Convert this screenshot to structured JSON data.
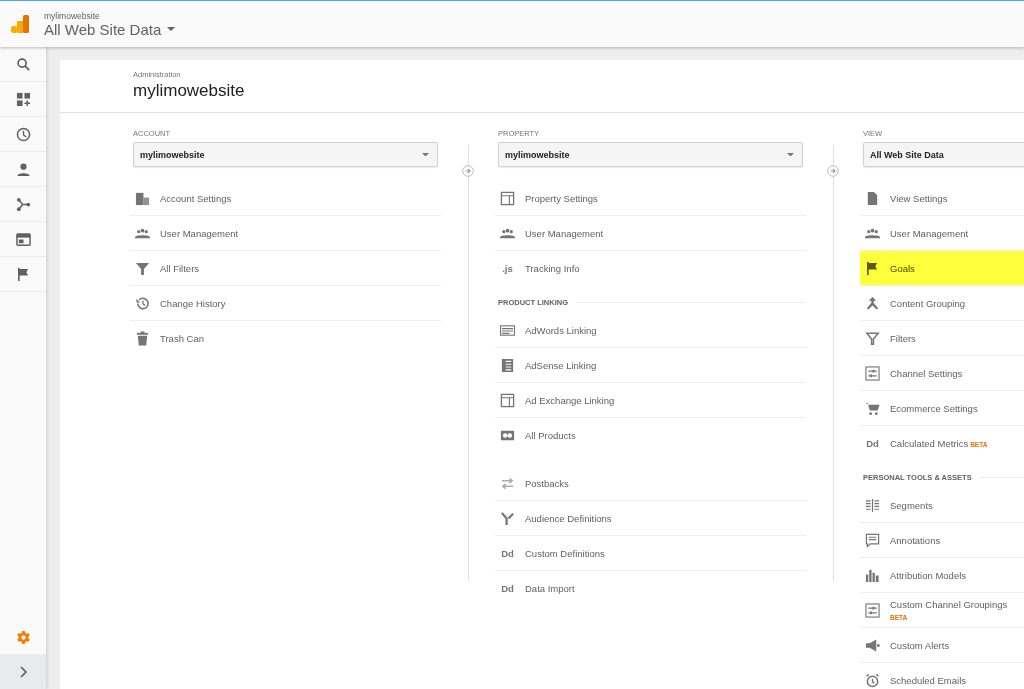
{
  "header": {
    "account_name": "mylimowebsite",
    "view_name": "All Web Site Data"
  },
  "sidebar": {
    "items": [
      {
        "kind": "search",
        "selected": false
      },
      {
        "kind": "dashboard",
        "selected": false
      },
      {
        "kind": "clock",
        "selected": false
      },
      {
        "kind": "person",
        "selected": false
      },
      {
        "kind": "nodes",
        "selected": false
      },
      {
        "kind": "window",
        "selected": false
      },
      {
        "kind": "flag",
        "selected": false
      }
    ],
    "admin": {
      "kind": "gear",
      "selected": true
    }
  },
  "page": {
    "breadcrumb": "Administration",
    "title": "mylimowebsite"
  },
  "columns": [
    {
      "label": "ACCOUNT",
      "dropdown": "mylimowebsite",
      "sections": [
        {
          "items": [
            {
              "label": "Account Settings",
              "kind": "building",
              "highlighted": false
            },
            {
              "label": "User Management",
              "kind": "people",
              "highlighted": false
            },
            {
              "label": "All Filters",
              "kind": "filter",
              "highlighted": false
            },
            {
              "label": "Change History",
              "kind": "history",
              "highlighted": false
            },
            {
              "label": "Trash Can",
              "kind": "trash",
              "highlighted": false
            }
          ]
        }
      ]
    },
    {
      "label": "PROPERTY",
      "dropdown": "mylimowebsite",
      "sections": [
        {
          "items": [
            {
              "label": "Property Settings",
              "kind": "panel",
              "highlighted": false
            },
            {
              "label": "User Management",
              "kind": "people",
              "highlighted": false
            },
            {
              "label": "Tracking Info",
              "kind": "text",
              "icon_text": ".js",
              "highlighted": false
            }
          ]
        },
        {
          "heading": "PRODUCT LINKING",
          "items": [
            {
              "label": "AdWords Linking",
              "kind": "card",
              "highlighted": false
            },
            {
              "label": "AdSense Linking",
              "kind": "listdoc",
              "highlighted": false
            },
            {
              "label": "Ad Exchange Linking",
              "kind": "panel",
              "highlighted": false
            },
            {
              "label": "All Products",
              "kind": "link",
              "highlighted": false
            }
          ]
        },
        {
          "items": [
            {
              "label": "Postbacks",
              "kind": "arrows",
              "highlighted": false
            },
            {
              "label": "Audience Definitions",
              "kind": "fork",
              "highlighted": false
            },
            {
              "label": "Custom Definitions",
              "kind": "text",
              "icon_text": "Dd",
              "highlighted": false
            },
            {
              "label": "Data Import",
              "kind": "text",
              "icon_text": "Dd",
              "highlighted": false
            }
          ]
        }
      ]
    },
    {
      "label": "VIEW",
      "dropdown": "All Web Site Data",
      "sections": [
        {
          "items": [
            {
              "label": "View Settings",
              "kind": "document",
              "highlighted": false
            },
            {
              "label": "User Management",
              "kind": "people",
              "highlighted": false
            },
            {
              "label": "Goals",
              "kind": "flag",
              "highlighted": true
            },
            {
              "label": "Content Grouping",
              "kind": "merge",
              "highlighted": false
            },
            {
              "label": "Filters",
              "kind": "filteroutline",
              "highlighted": false
            },
            {
              "label": "Channel Settings",
              "kind": "channel",
              "highlighted": false
            },
            {
              "label": "Ecommerce Settings",
              "kind": "cart",
              "highlighted": false
            },
            {
              "label": "Calculated Metrics",
              "kind": "text",
              "icon_text": "Dd",
              "badge": "BETA",
              "highlighted": false
            }
          ]
        },
        {
          "heading": "PERSONAL TOOLS & ASSETS",
          "items": [
            {
              "label": "Segments",
              "kind": "segments",
              "highlighted": false
            },
            {
              "label": "Annotations",
              "kind": "bubble",
              "highlighted": false
            },
            {
              "label": "Attribution Models",
              "kind": "bars",
              "highlighted": false
            },
            {
              "label": "Custom Channel Groupings",
              "kind": "channel",
              "badge": "BETA",
              "badge_below": true,
              "highlighted": false
            },
            {
              "label": "Custom Alerts",
              "kind": "megaphone",
              "highlighted": false
            },
            {
              "label": "Scheduled Emails",
              "kind": "alarm",
              "highlighted": false
            }
          ]
        }
      ]
    }
  ]
}
